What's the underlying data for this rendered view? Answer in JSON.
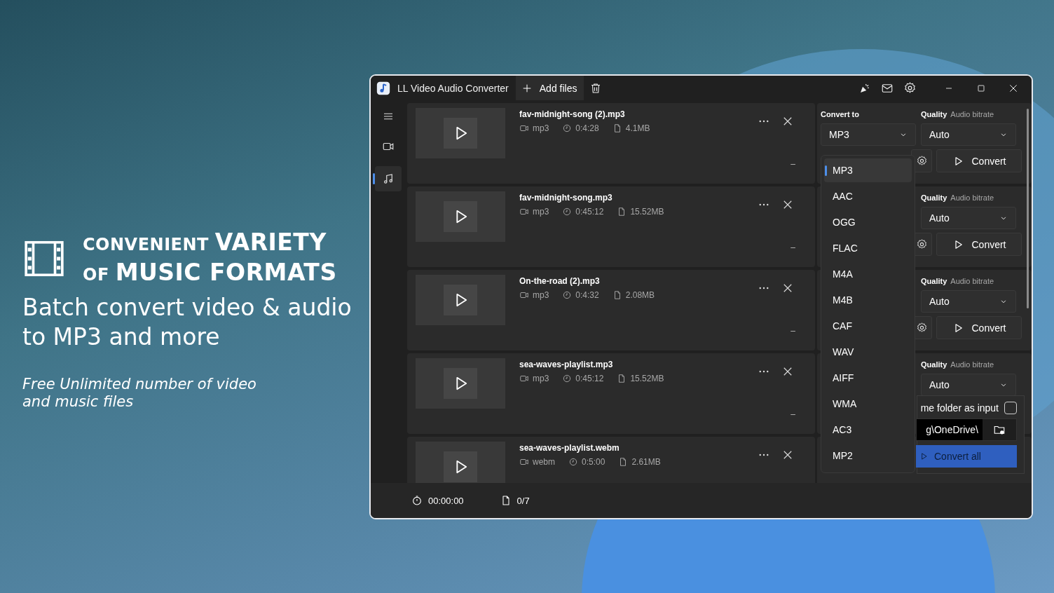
{
  "promo": {
    "heading": "CONVENIENT **VARIETY** OF **MUSIC FORMATS**",
    "subtitle": "Batch convert video & audio to MP3 and more",
    "tagline": "Free Unlimited number of video and music files"
  },
  "window": {
    "title": "LL Video Audio Converter",
    "add_files": "Add files"
  },
  "sidebar": {
    "nav": [
      {
        "kind": "video",
        "selected": false
      },
      {
        "kind": "audio",
        "selected": true
      }
    ]
  },
  "files": [
    {
      "name": "fav-midnight-song (2).mp3",
      "format": "mp3",
      "duration": "0:4:28",
      "size": "4.1MB",
      "status": "–",
      "convert_to_label": "Convert to",
      "target": "MP3",
      "quality_label": "Quality",
      "quality_hint": "Audio bitrate",
      "quality": "Auto",
      "convert": "Convert"
    },
    {
      "name": "fav-midnight-song.mp3",
      "format": "mp3",
      "duration": "0:45:12",
      "size": "15.52MB",
      "status": "–",
      "quality_label": "Quality",
      "quality_hint": "Audio bitrate",
      "quality": "Auto",
      "convert": "Convert"
    },
    {
      "name": "On-the-road (2).mp3",
      "format": "mp3",
      "duration": "0:4:32",
      "size": "2.08MB",
      "status": "–",
      "quality_label": "Quality",
      "quality_hint": "Audio bitrate",
      "quality": "Auto",
      "convert": "Convert"
    },
    {
      "name": "sea-waves-playlist.mp3",
      "format": "mp3",
      "duration": "0:45:12",
      "size": "15.52MB",
      "status": "–",
      "quality_label": "Quality",
      "quality_hint": "Audio bitrate",
      "quality": "Auto"
    },
    {
      "name": "sea-waves-playlist.webm",
      "format": "webm",
      "duration": "0:5:00",
      "size": "2.61MB"
    }
  ],
  "format_menu": [
    {
      "label": "MP3",
      "selected": true
    },
    {
      "label": "AAC",
      "selected": false
    },
    {
      "label": "OGG",
      "selected": false
    },
    {
      "label": "FLAC",
      "selected": false
    },
    {
      "label": "M4A",
      "selected": false
    },
    {
      "label": "M4B",
      "selected": false
    },
    {
      "label": "CAF",
      "selected": false
    },
    {
      "label": "WAV",
      "selected": false
    },
    {
      "label": "AIFF",
      "selected": false
    },
    {
      "label": "WMA",
      "selected": false
    },
    {
      "label": "AC3",
      "selected": false
    },
    {
      "label": "MP2",
      "selected": false
    }
  ],
  "output": {
    "same_folder_label": "me folder as input",
    "same_folder": false,
    "path": "g\\OneDrive\\",
    "convert_all": "Convert all"
  },
  "status_bar": {
    "elapsed": "00:00:00",
    "count": "0/7"
  }
}
